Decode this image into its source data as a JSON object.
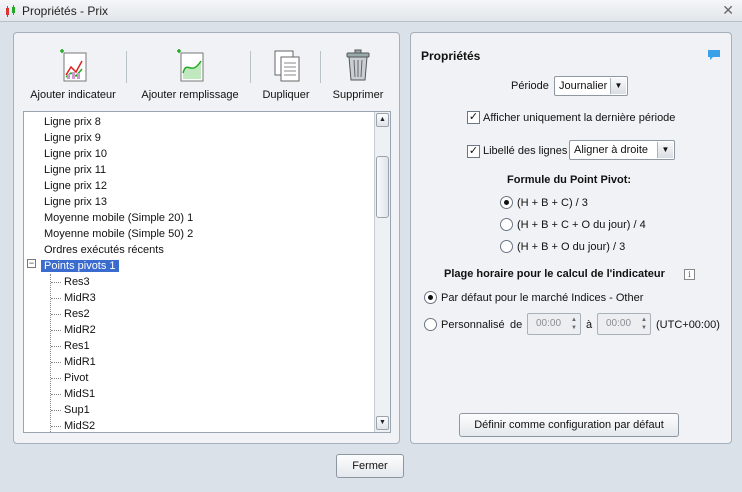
{
  "window": {
    "title": "Propriétés - Prix"
  },
  "toolbar": {
    "add_indicator": "Ajouter indicateur",
    "add_fill": "Ajouter remplissage",
    "duplicate": "Dupliquer",
    "delete": "Supprimer"
  },
  "tree": {
    "items": [
      "Ligne prix 8",
      "Ligne prix 9",
      "Ligne prix 10",
      "Ligne prix 11",
      "Ligne prix 12",
      "Ligne prix 13",
      "Moyenne mobile (Simple 20) 1",
      "Moyenne mobile (Simple 50) 2",
      "Ordres exécutés récents",
      "Points pivots 1"
    ],
    "children": [
      "Res3",
      "MidR3",
      "Res2",
      "MidR2",
      "Res1",
      "MidR1",
      "Pivot",
      "MidS1",
      "Sup1",
      "MidS2"
    ]
  },
  "props": {
    "title": "Propriétés",
    "period_label": "Période",
    "period_value": "Journalier",
    "last_period_label": "Afficher uniquement la dernière période",
    "line_labels_label": "Libellé des lignes",
    "line_labels_value": "Aligner à droite",
    "formula_heading": "Formule du Point Pivot:",
    "formula_options": [
      "(H + B + C) / 3",
      "(H + B + C + O du jour) / 4",
      "(H + B + O du jour) / 3"
    ],
    "timerange_heading": "Plage horaire pour le calcul de l'indicateur",
    "default_market_label": "Par défaut pour le marché Indices - Other",
    "custom_label": "Personnalisé",
    "from_label": "de",
    "from_time": "00:00",
    "to_label": "à",
    "to_time": "00:00",
    "timezone": "(UTC+00:00)",
    "set_default_button": "Définir comme configuration par défaut"
  },
  "footer": {
    "close_button": "Fermer"
  },
  "colors": {
    "selection": "#3a6ccf",
    "panel": "#f0f2f5",
    "background": "#dbe1e8"
  }
}
